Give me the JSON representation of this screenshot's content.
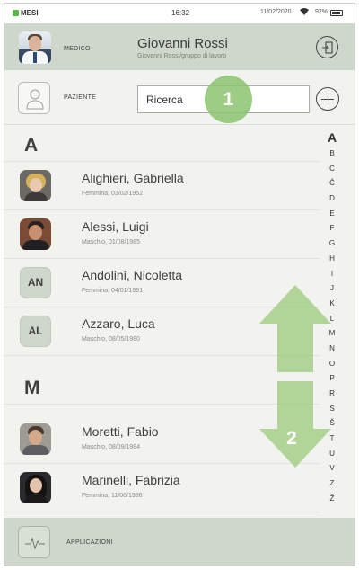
{
  "status_bar": {
    "app_name": "MESI",
    "time": "16:32",
    "date": "11/02/2020",
    "battery": "92%"
  },
  "header": {
    "role": "MEDICO",
    "doctor_name": "Giovanni Rossi",
    "doctor_subtitle": "Giovanni Rossi/gruppo di lavoro"
  },
  "patient_bar": {
    "label": "PAZIENTE",
    "search_value": "Ricerca"
  },
  "sections": [
    {
      "letter": "A",
      "patients": [
        {
          "name": "Alighieri, Gabriella",
          "meta": "Femmina, 03/02/1952",
          "initials": ""
        },
        {
          "name": "Alessi, Luigi",
          "meta": "Maschio, 01/08/1985",
          "initials": ""
        },
        {
          "name": "Andolini, Nicoletta",
          "meta": "Femmina, 04/01/1991",
          "initials": "AN"
        },
        {
          "name": "Azzaro, Luca",
          "meta": "Maschio, 08/05/1980",
          "initials": "AL"
        }
      ]
    },
    {
      "letter": "M",
      "patients": [
        {
          "name": "Moretti, Fabio",
          "meta": "Maschio, 08/09/1984",
          "initials": ""
        },
        {
          "name": "Marinelli, Fabrizia",
          "meta": "Femmina, 11/06/1986",
          "initials": ""
        }
      ]
    }
  ],
  "alphabet": {
    "current": "A",
    "letters": [
      "B",
      "C",
      "Č",
      "D",
      "E",
      "F",
      "G",
      "H",
      "I",
      "J",
      "K",
      "L",
      "M",
      "N",
      "O",
      "P",
      "R",
      "S",
      "Š",
      "T",
      "U",
      "V",
      "Z",
      "Ž"
    ]
  },
  "annotations": {
    "marker1": "1",
    "marker2": "2"
  },
  "footer": {
    "label": "APPLICAZIONI"
  },
  "colors": {
    "header_bg": "#cfd7cc",
    "marker_green": "#8cc36e",
    "background": "#f2f2ef"
  }
}
